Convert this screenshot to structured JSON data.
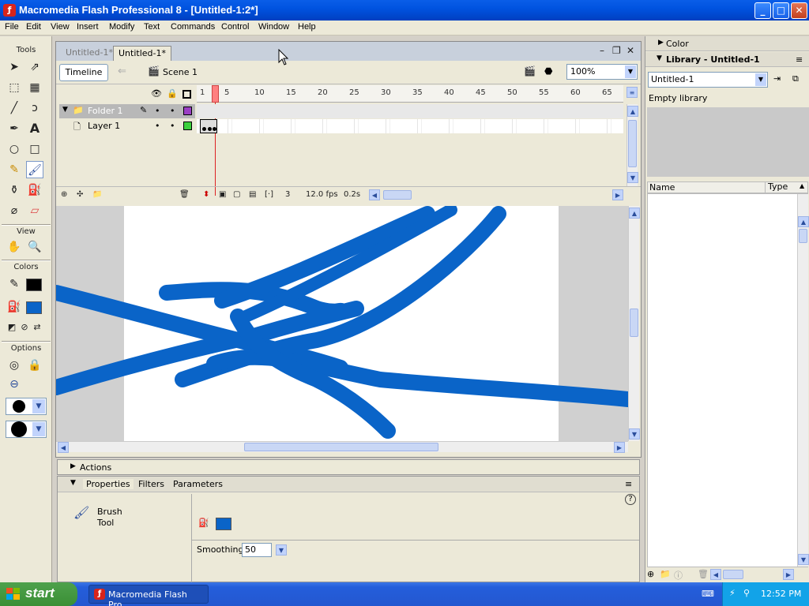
{
  "window": {
    "title": "Macromedia Flash Professional 8 - [Untitled-1:2*]",
    "controls": {
      "minimize": "_",
      "maximize": "□",
      "close": "✕"
    }
  },
  "menu": [
    "File",
    "Edit",
    "View",
    "Insert",
    "Modify",
    "Text",
    "Commands",
    "Control",
    "Window",
    "Help"
  ],
  "tools_panel": {
    "title": "Tools",
    "view_label": "View",
    "colors_label": "Colors",
    "options_label": "Options",
    "stroke_color": "#000000",
    "fill_color": "#0a64c8"
  },
  "document": {
    "tabs": [
      "Untitled-1*",
      "Untitled-1*"
    ],
    "active_tab": 1,
    "timeline_button": "Timeline",
    "scene_label": "Scene 1",
    "zoom": "100%"
  },
  "timeline": {
    "ruler_ticks": [
      "1",
      "5",
      "10",
      "15",
      "20",
      "25",
      "30",
      "35",
      "40",
      "45",
      "50",
      "55",
      "60",
      "65"
    ],
    "layers": [
      {
        "name": "Folder 1",
        "type": "folder"
      },
      {
        "name": "Layer 1",
        "type": "layer"
      }
    ],
    "current_frame": "3",
    "fps": "12.0 fps",
    "time": "0.2s"
  },
  "stage": {
    "stroke_color": "#0a64c8"
  },
  "panels": {
    "actions": "Actions",
    "properties_tabs": [
      "Properties",
      "Filters",
      "Parameters"
    ],
    "tool_name_line1": "Brush",
    "tool_name_line2": "Tool",
    "smoothing_label": "Smoothing",
    "smoothing_value": "50",
    "help": "?"
  },
  "right_panels": {
    "color_title": "Color",
    "library_title": "Library - Untitled-1",
    "library_select": "Untitled-1",
    "empty_text": "Empty library",
    "columns": [
      "Name",
      "Type"
    ]
  },
  "taskbar": {
    "start": "start",
    "task": "Macromedia Flash Pro...",
    "clock": "12:52 PM"
  }
}
